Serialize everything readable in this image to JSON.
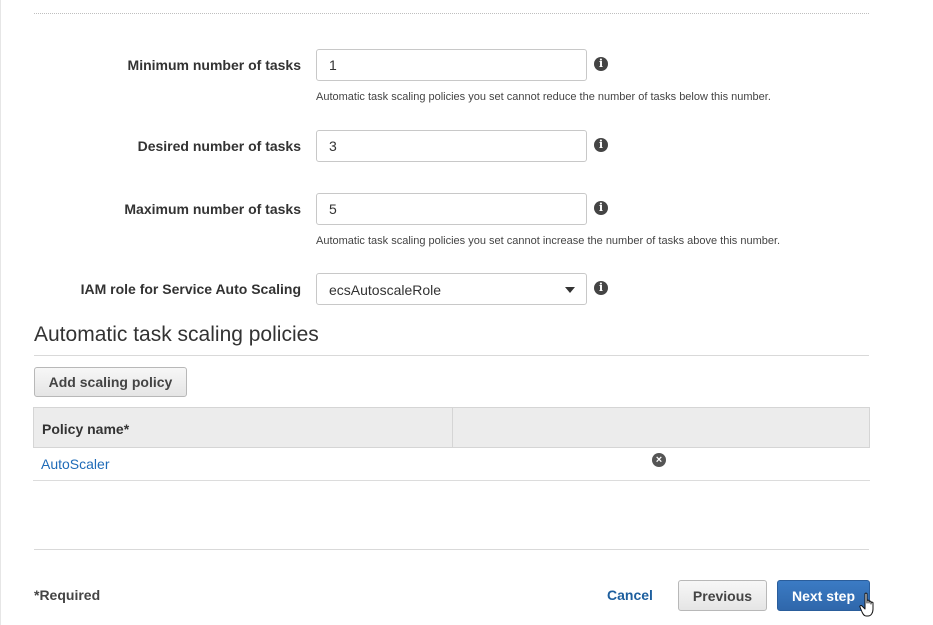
{
  "form": {
    "min_tasks": {
      "label": "Minimum number of tasks",
      "value": "1",
      "help": "Automatic task scaling policies you set cannot reduce the number of tasks below this number."
    },
    "desired_tasks": {
      "label": "Desired number of tasks",
      "value": "3"
    },
    "max_tasks": {
      "label": "Maximum number of tasks",
      "value": "5",
      "help": "Automatic task scaling policies you set cannot increase the number of tasks above this number."
    },
    "iam_role": {
      "label": "IAM role for Service Auto Scaling",
      "value": "ecsAutoscaleRole"
    },
    "info_glyph": "i"
  },
  "policies": {
    "title": "Automatic task scaling policies",
    "add_button": "Add scaling policy",
    "columns": [
      "Policy name*",
      ""
    ],
    "rows": [
      {
        "name": "AutoScaler",
        "remove_glyph": "×"
      }
    ]
  },
  "footer": {
    "required_note": "*Required",
    "cancel": "Cancel",
    "previous": "Previous",
    "next": "Next step"
  },
  "icons": {
    "info": "info-circle-icon",
    "remove": "remove-circle-icon",
    "dropdown": "caret-down-icon",
    "cursor": "hand-pointer-icon"
  },
  "colors": {
    "primary_button": "#2f67ab",
    "link": "#1e6bb8",
    "table_header": "#ececec"
  }
}
